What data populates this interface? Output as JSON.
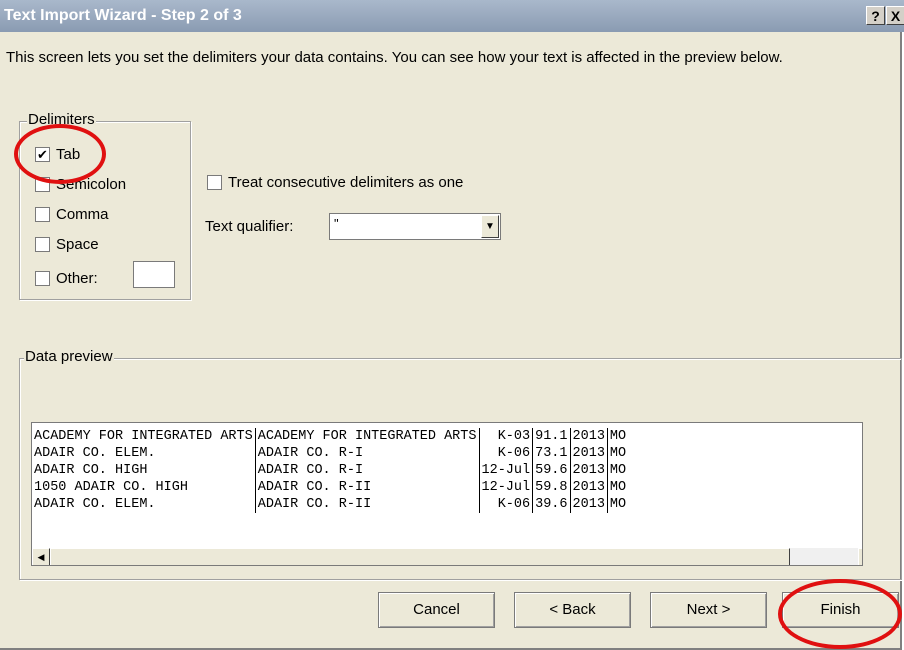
{
  "window": {
    "title": "Text Import Wizard - Step 2 of 3",
    "help_label": "?",
    "close_label": "X"
  },
  "description": "This screen lets you set the delimiters your data contains.  You can see how your text is affected in the preview below.",
  "delimiters": {
    "legend": "Delimiters",
    "tab": {
      "label": "Tab",
      "checked": true
    },
    "semicolon": {
      "label": "Semicolon",
      "checked": false
    },
    "comma": {
      "label": "Comma",
      "checked": false
    },
    "space": {
      "label": "Space",
      "checked": false
    },
    "other": {
      "label": "Other:",
      "checked": false,
      "value": ""
    }
  },
  "options": {
    "consecutive": {
      "label": "Treat consecutive delimiters as one",
      "checked": false
    },
    "qualifier_label": "Text qualifier:",
    "qualifier_value": "\""
  },
  "preview": {
    "legend": "Data preview",
    "rows": [
      [
        "ACADEMY FOR INTEGRATED ARTS",
        "ACADEMY FOR INTEGRATED ARTS",
        "K-03",
        "91.1",
        "2013",
        "MO"
      ],
      [
        "ADAIR CO. ELEM.",
        "ADAIR CO. R-I",
        "K-06",
        "73.1",
        "2013",
        "MO"
      ],
      [
        "ADAIR CO. HIGH",
        "ADAIR CO. R-I",
        "12-Jul",
        "59.6",
        "2013",
        "MO"
      ],
      [
        "1050 ADAIR CO. HIGH",
        "ADAIR CO. R-II",
        "12-Jul",
        "59.8",
        "2013",
        "MO"
      ],
      [
        "ADAIR CO. ELEM.",
        "ADAIR CO. R-II",
        "K-06",
        "39.6",
        "2013",
        "MO"
      ]
    ]
  },
  "buttons": {
    "cancel": "Cancel",
    "back": "< Back",
    "next": "Next >",
    "finish": "Finish"
  },
  "colors": {
    "titlebar": "#8a9bb2",
    "annotation_circle": "#e01010",
    "dialog_bg": "#ece9d8"
  }
}
